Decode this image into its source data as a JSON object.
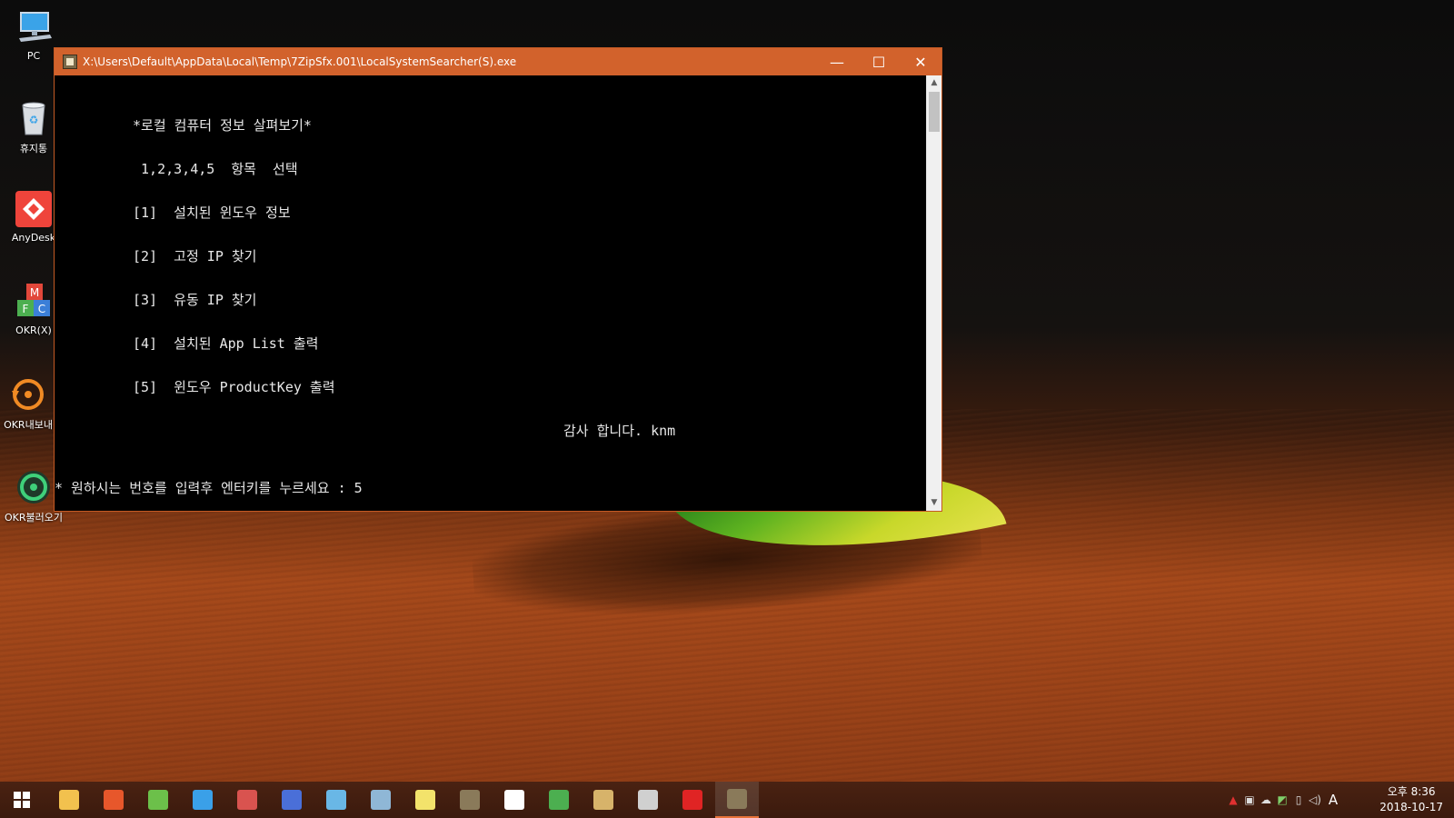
{
  "desktop": {
    "icons": [
      {
        "label": "PC",
        "icon": "computer-icon"
      },
      {
        "label": "휴지통",
        "icon": "recycle-bin-icon"
      },
      {
        "label": "AnyDesk",
        "icon": "anydesk-icon"
      },
      {
        "label": "OKR(X)",
        "icon": "okr-x-icon"
      },
      {
        "label": "OKR내보내",
        "icon": "okr-export-icon"
      },
      {
        "label": "OKR불러오기",
        "icon": "okr-import-icon"
      }
    ]
  },
  "window": {
    "title": "X:\\Users\\Default\\AppData\\Local\\Temp\\7ZipSfx.001\\LocalSystemSearcher(S).exe",
    "minimize": "—",
    "maximize": "☐",
    "close": "✕",
    "console": {
      "heading": "*로컬 컴퓨터 정보 살펴보기*",
      "instruction": " 1,2,3,4,5  항목  선택",
      "options": [
        "[1]  설치된 윈도우 정보",
        "[2]  고정 IP 찾기",
        "[3]  유동 IP 찾기",
        "[4]  설치된 App List 출력",
        "[5]  윈도우 ProductKey 출력"
      ],
      "thanks": "감사 합니다. knm",
      "prompt": "* 원하시는 번호를 입력후 엔터키를 누르세요 : 5"
    }
  },
  "taskbar": {
    "start_icon": "windows-start-icon",
    "apps": [
      {
        "name": "file-explorer-icon",
        "color": "#f2c14e"
      },
      {
        "name": "paint-app-icon",
        "color": "#e7572b"
      },
      {
        "name": "puzzle-app-icon",
        "color": "#6cc04a"
      },
      {
        "name": "sail-app-icon",
        "color": "#3aa0e8"
      },
      {
        "name": "disk-app-icon",
        "color": "#d9534f"
      },
      {
        "name": "user-app-icon",
        "color": "#4a6fd8"
      },
      {
        "name": "document-app-icon",
        "color": "#69b7e6"
      },
      {
        "name": "gallery-app-icon",
        "color": "#8fb7d6"
      },
      {
        "name": "bird-app-icon",
        "color": "#f3e36b"
      },
      {
        "name": "system-searcher-icon",
        "color": "#8a7a5a"
      },
      {
        "name": "capture-app-icon",
        "color": "#ffffff"
      },
      {
        "name": "chrome-icon",
        "color": "#4caf50"
      },
      {
        "name": "archive-app-icon",
        "color": "#d7b36a"
      },
      {
        "name": "tools-app-icon",
        "color": "#d0d0d0"
      },
      {
        "name": "close-app-icon",
        "color": "#e02424"
      },
      {
        "name": "active-app-icon",
        "color": "#8a7a5a"
      }
    ],
    "tray": {
      "icons": [
        "network-alert-icon",
        "monitor-icon",
        "cloud-icon",
        "security-icon",
        "usb-icon",
        "volume-icon"
      ],
      "ime": "A",
      "time": "오후 8:36",
      "date": "2018-10-17"
    }
  }
}
